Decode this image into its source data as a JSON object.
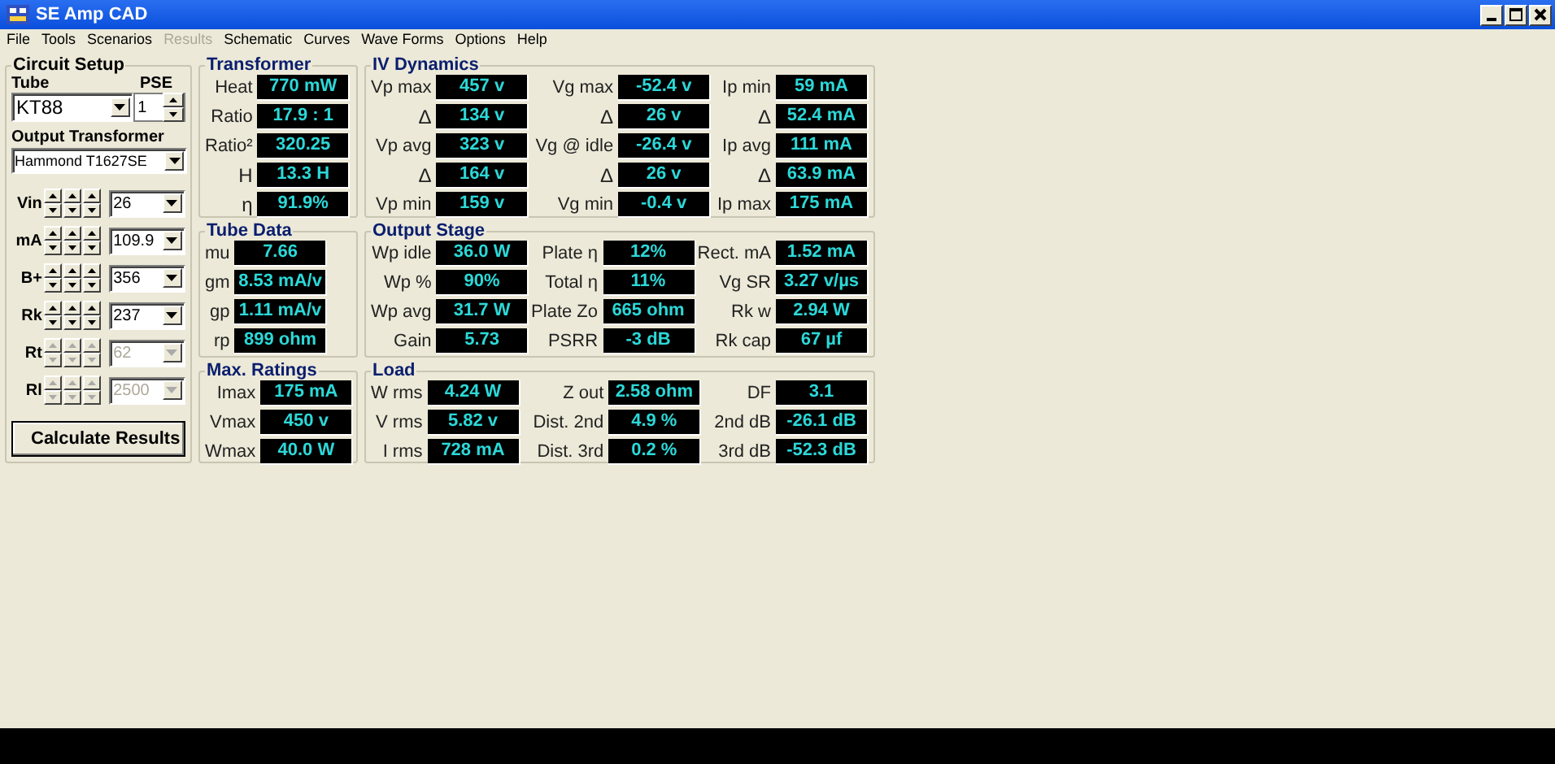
{
  "window": {
    "title": "SE Amp CAD"
  },
  "menu": [
    {
      "label": "File",
      "disabled": false
    },
    {
      "label": "Tools",
      "disabled": false
    },
    {
      "label": "Scenarios",
      "disabled": false
    },
    {
      "label": "Results",
      "disabled": true
    },
    {
      "label": "Schematic",
      "disabled": false
    },
    {
      "label": "Curves",
      "disabled": false
    },
    {
      "label": "Wave Forms",
      "disabled": false
    },
    {
      "label": "Options",
      "disabled": false
    },
    {
      "label": "Help",
      "disabled": false
    }
  ],
  "circuit_setup": {
    "title": "Circuit Setup",
    "tube": {
      "label": "Tube",
      "value": "KT88"
    },
    "pse": {
      "label": "PSE",
      "value": "1"
    },
    "output_transformer": {
      "label": "Output Transformer",
      "value": "Hammond T1627SE"
    },
    "parameters": [
      {
        "label": "Vin",
        "value": "26",
        "disabled": false
      },
      {
        "label": "mA",
        "value": "109.9",
        "disabled": false
      },
      {
        "label": "B+",
        "value": "356",
        "disabled": false
      },
      {
        "label": "Rk",
        "value": "237",
        "disabled": false
      },
      {
        "label": "Rt",
        "value": "62",
        "disabled": true
      },
      {
        "label": "Rl",
        "value": "2500",
        "disabled": true
      }
    ],
    "calculate_button": "Calculate Results"
  },
  "groups": [
    {
      "title": "Transformer",
      "columns": [
        [
          {
            "label": "Heat",
            "value": "770 mW"
          },
          {
            "label": "Ratio",
            "value": "17.9 : 1"
          },
          {
            "label": "Ratio²",
            "value": "320.25"
          },
          {
            "label": "H",
            "value": "13.3 H"
          },
          {
            "label": "η",
            "value": "91.9%"
          }
        ]
      ]
    },
    {
      "title": "IV Dynamics",
      "columns": [
        [
          {
            "label": "Vp max",
            "value": "457 v"
          },
          {
            "label": "Δ",
            "value": "134 v"
          },
          {
            "label": "Vp avg",
            "value": "323 v"
          },
          {
            "label": "Δ",
            "value": "164 v"
          },
          {
            "label": "Vp min",
            "value": "159 v"
          }
        ],
        [
          {
            "label": "Vg max",
            "value": "-52.4 v"
          },
          {
            "label": "Δ",
            "value": "26 v"
          },
          {
            "label": "Vg @ idle",
            "value": "-26.4 v"
          },
          {
            "label": "Δ",
            "value": "26 v"
          },
          {
            "label": "Vg min",
            "value": "-0.4 v"
          }
        ],
        [
          {
            "label": "Ip min",
            "value": "59 mA"
          },
          {
            "label": "Δ",
            "value": "52.4 mA"
          },
          {
            "label": "Ip avg",
            "value": "111 mA"
          },
          {
            "label": "Δ",
            "value": "63.9 mA"
          },
          {
            "label": "Ip max",
            "value": "175 mA"
          }
        ]
      ]
    },
    {
      "title": "Tube Data",
      "columns": [
        [
          {
            "label": "mu",
            "value": "7.66"
          },
          {
            "label": "gm",
            "value": "8.53 mA/v"
          },
          {
            "label": "gp",
            "value": "1.11 mA/v"
          },
          {
            "label": "rp",
            "value": "899 ohm"
          }
        ]
      ]
    },
    {
      "title": "Output Stage",
      "columns": [
        [
          {
            "label": "Wp idle",
            "value": "36.0 W"
          },
          {
            "label": "Wp %",
            "value": "90%"
          },
          {
            "label": "Wp avg",
            "value": "31.7 W"
          },
          {
            "label": "Gain",
            "value": "5.73"
          }
        ],
        [
          {
            "label": "Plate η",
            "value": "12%"
          },
          {
            "label": "Total η",
            "value": "11%"
          },
          {
            "label": "Plate Zo",
            "value": "665 ohm"
          },
          {
            "label": "PSRR",
            "value": "-3 dB"
          }
        ],
        [
          {
            "label": "Rect. mA",
            "value": "1.52 mA"
          },
          {
            "label": "Vg SR",
            "value": "3.27 v/µs"
          },
          {
            "label": "Rk w",
            "value": "2.94 W"
          },
          {
            "label": "Rk cap",
            "value": "67 µf"
          }
        ]
      ]
    },
    {
      "title": "Max. Ratings",
      "columns": [
        [
          {
            "label": "Imax",
            "value": "175 mA"
          },
          {
            "label": "Vmax",
            "value": "450 v"
          },
          {
            "label": "Wmax",
            "value": "40.0 W"
          }
        ]
      ]
    },
    {
      "title": "Load",
      "columns": [
        [
          {
            "label": "W rms",
            "value": "4.24 W"
          },
          {
            "label": "V rms",
            "value": "5.82 v"
          },
          {
            "label": "I rms",
            "value": "728 mA"
          }
        ],
        [
          {
            "label": "Z out",
            "value": "2.58 ohm"
          },
          {
            "label": "Dist. 2nd",
            "value": "4.9 %"
          },
          {
            "label": "Dist. 3rd",
            "value": "0.2 %"
          }
        ],
        [
          {
            "label": "DF",
            "value": "3.1"
          },
          {
            "label": "2nd dB",
            "value": "-26.1 dB"
          },
          {
            "label": "3rd dB",
            "value": "-52.3 dB"
          }
        ]
      ]
    }
  ]
}
